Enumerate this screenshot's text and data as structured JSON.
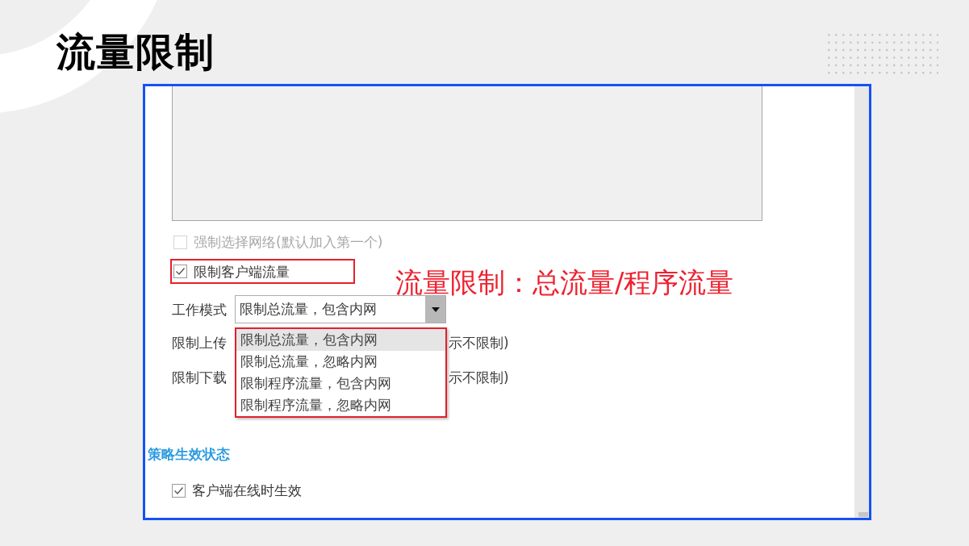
{
  "slide": {
    "title": "流量限制"
  },
  "panel": {
    "options": [
      {
        "label": "强制选择网络(默认加入第一个)",
        "checked": false,
        "disabled": true,
        "highlighted": false
      },
      {
        "label": "限制客户端流量",
        "checked": true,
        "disabled": false,
        "highlighted": true
      }
    ],
    "annotation": "流量限制：总流量/程序流量",
    "work_mode": {
      "label": "工作模式",
      "value": "限制总流量，包含内网",
      "expanded": true,
      "highlighted": true,
      "options": [
        {
          "label": "限制总流量，包含内网",
          "selected": true
        },
        {
          "label": "限制总流量，忽略内网",
          "selected": false
        },
        {
          "label": "限制程序流量，包含内网",
          "selected": false
        },
        {
          "label": "限制程序流量，忽略内网",
          "selected": false
        }
      ]
    },
    "limit_rows": [
      {
        "label": "限制上传",
        "hint": "示不限制)"
      },
      {
        "label": "限制下载",
        "hint": "示不限制)"
      }
    ],
    "status_section": {
      "title": "策略生效状态",
      "options": [
        {
          "label": "客户端在线时生效",
          "checked": true
        }
      ]
    }
  }
}
